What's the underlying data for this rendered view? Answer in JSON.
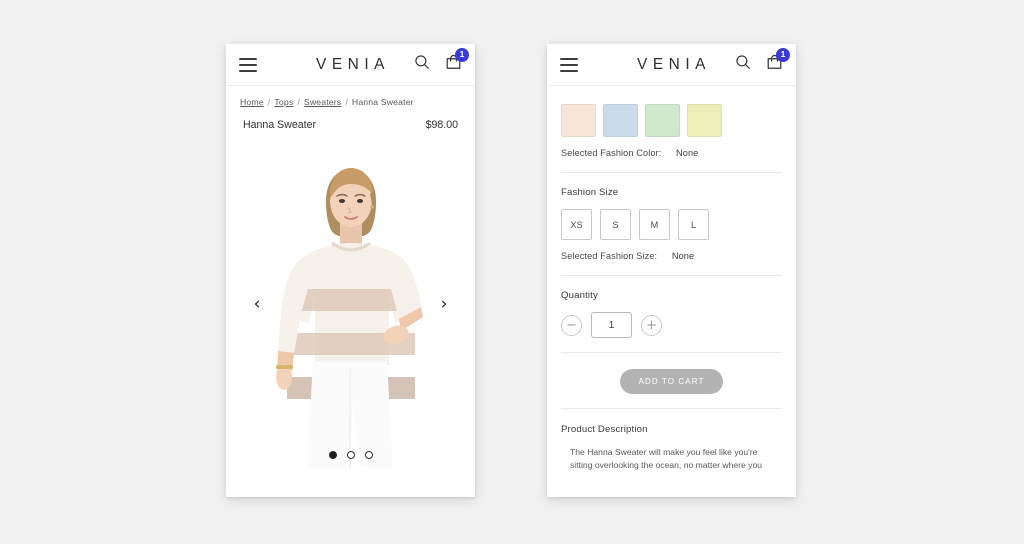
{
  "background_color": "#f1f1f1",
  "header": {
    "brand": "VENIA",
    "menu_icon": "hamburger-menu-icon",
    "search_icon": "search-icon",
    "cart_icon": "shopping-bag-icon",
    "cart_badge_count": "1",
    "badge_color": "#3a3ad6"
  },
  "left_screen": {
    "breadcrumb": {
      "items": [
        {
          "label": "Home",
          "is_link": true
        },
        {
          "label": "Tops",
          "is_link": true
        },
        {
          "label": "Sweaters",
          "is_link": true
        },
        {
          "label": "Hanna Sweater",
          "is_link": false
        }
      ],
      "separator": "/"
    },
    "product": {
      "name": "Hanna Sweater",
      "price": "$98.00"
    },
    "gallery": {
      "prev_icon": "chevron-left-icon",
      "prev_glyph": "‹",
      "next_icon": "chevron-right-icon",
      "next_glyph": "›",
      "dots": [
        {
          "active": true
        },
        {
          "active": false
        },
        {
          "active": false
        }
      ],
      "image_alt": "blonde-model-wearing-beige-striped-sweater-and-white-pants"
    }
  },
  "right_screen": {
    "color_swatches": [
      {
        "name": "peach",
        "hex": "#f7e6d8"
      },
      {
        "name": "light-blue",
        "hex": "#cadcea"
      },
      {
        "name": "light-green",
        "hex": "#cfe8ce"
      },
      {
        "name": "light-yellow",
        "hex": "#eeeeb9"
      }
    ],
    "selected_color": {
      "label": "Selected Fashion Color:",
      "value": "None"
    },
    "size": {
      "section_label": "Fashion Size",
      "options": [
        "XS",
        "S",
        "M",
        "L"
      ],
      "selected_label": "Selected Fashion Size:",
      "selected_value": "None"
    },
    "quantity": {
      "section_label": "Quantity",
      "decrement_icon": "minus-circle-icon",
      "decrement_glyph": "−",
      "increment_icon": "plus-circle-icon",
      "increment_glyph": "+",
      "value": "1"
    },
    "add_to_cart": {
      "label": "ADD TO CART",
      "color": "#b3b3b3"
    },
    "description": {
      "title": "Product Description",
      "text": "The Hanna Sweater will make you feel like you're sitting overlooking the ocean, no matter where you"
    }
  }
}
